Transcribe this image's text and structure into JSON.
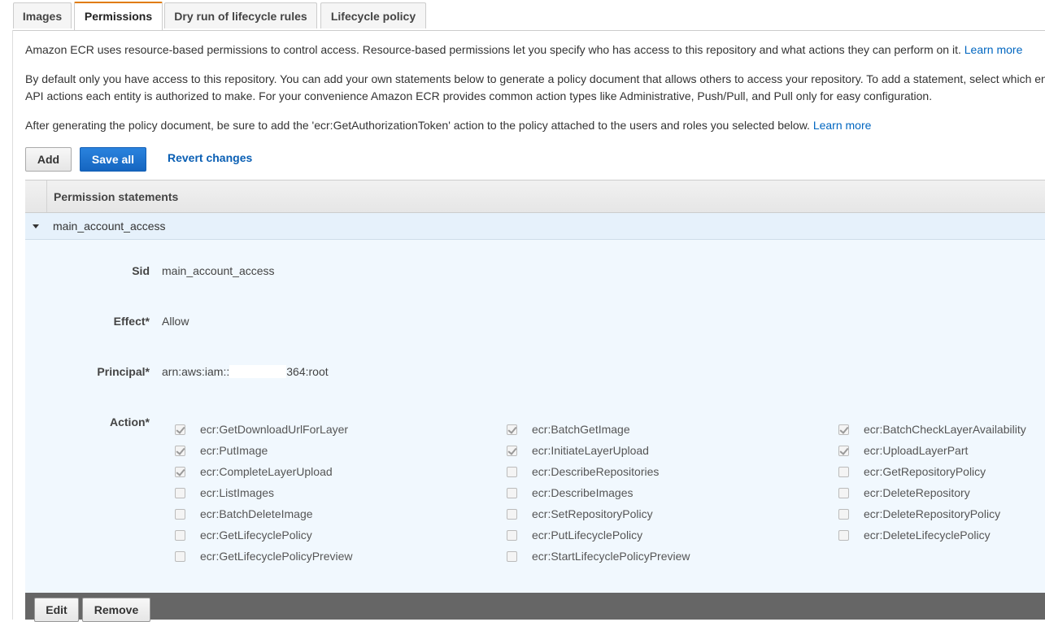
{
  "tabs": [
    {
      "label": "Images"
    },
    {
      "label": "Permissions",
      "active": true
    },
    {
      "label": "Dry run of lifecycle rules"
    },
    {
      "label": "Lifecycle policy"
    }
  ],
  "intro": {
    "p1_text": "Amazon ECR uses resource-based permissions to control access. Resource-based permissions let you specify who has access to this repository and what actions they can perform on it.",
    "p1_link": "Learn more",
    "p2_line1": "By default only you have access to this repository. You can add your own statements below to generate a policy document that allows others to access your repository. To add a statement, select which en",
    "p2_line2": "API actions each entity is authorized to make. For your convenience Amazon ECR provides common action types like Administrative, Push/Pull, and Pull only for easy configuration.",
    "p3_text": "After generating the policy document, be sure to add the 'ecr:GetAuthorizationToken' action to the policy attached to the users and roles you selected below.",
    "p3_link": "Learn more"
  },
  "toolbar": {
    "add_label": "Add",
    "save_all_label": "Save all",
    "revert_label": "Revert changes"
  },
  "table": {
    "header": "Permission statements",
    "statement_name": "main_account_access"
  },
  "statement": {
    "sid_label": "Sid",
    "sid_value": "main_account_access",
    "effect_label": "Effect*",
    "effect_value": "Allow",
    "principal_label": "Principal*",
    "principal_prefix": "arn:aws:iam::",
    "principal_suffix": "364:root",
    "action_label": "Action*"
  },
  "actions": [
    {
      "name": "ecr:GetDownloadUrlForLayer",
      "checked": true
    },
    {
      "name": "ecr:BatchGetImage",
      "checked": true
    },
    {
      "name": "ecr:BatchCheckLayerAvailability",
      "checked": true
    },
    {
      "name": "ecr:PutImage",
      "checked": true
    },
    {
      "name": "ecr:InitiateLayerUpload",
      "checked": true
    },
    {
      "name": "ecr:UploadLayerPart",
      "checked": true
    },
    {
      "name": "ecr:CompleteLayerUpload",
      "checked": true
    },
    {
      "name": "ecr:DescribeRepositories",
      "checked": false
    },
    {
      "name": "ecr:GetRepositoryPolicy",
      "checked": false
    },
    {
      "name": "ecr:ListImages",
      "checked": false
    },
    {
      "name": "ecr:DescribeImages",
      "checked": false
    },
    {
      "name": "ecr:DeleteRepository",
      "checked": false
    },
    {
      "name": "ecr:BatchDeleteImage",
      "checked": false
    },
    {
      "name": "ecr:SetRepositoryPolicy",
      "checked": false
    },
    {
      "name": "ecr:DeleteRepositoryPolicy",
      "checked": false
    },
    {
      "name": "ecr:GetLifecyclePolicy",
      "checked": false
    },
    {
      "name": "ecr:PutLifecyclePolicy",
      "checked": false
    },
    {
      "name": "ecr:DeleteLifecyclePolicy",
      "checked": false
    },
    {
      "name": "ecr:GetLifecyclePolicyPreview",
      "checked": false
    },
    {
      "name": "ecr:StartLifecyclePolicyPreview",
      "checked": false
    }
  ],
  "footer": {
    "edit_label": "Edit",
    "remove_label": "Remove"
  },
  "colors": {
    "accent_tab": "#e07b00",
    "primary_button": "#1565c0",
    "link": "#0066c0",
    "statement_bg": "#f1f8fe",
    "footer_bg": "#666666"
  },
  "icons": {
    "expand": "caret-down-icon",
    "checkbox": "checkbox-icon",
    "cursor": "mouse-pointer-icon"
  }
}
